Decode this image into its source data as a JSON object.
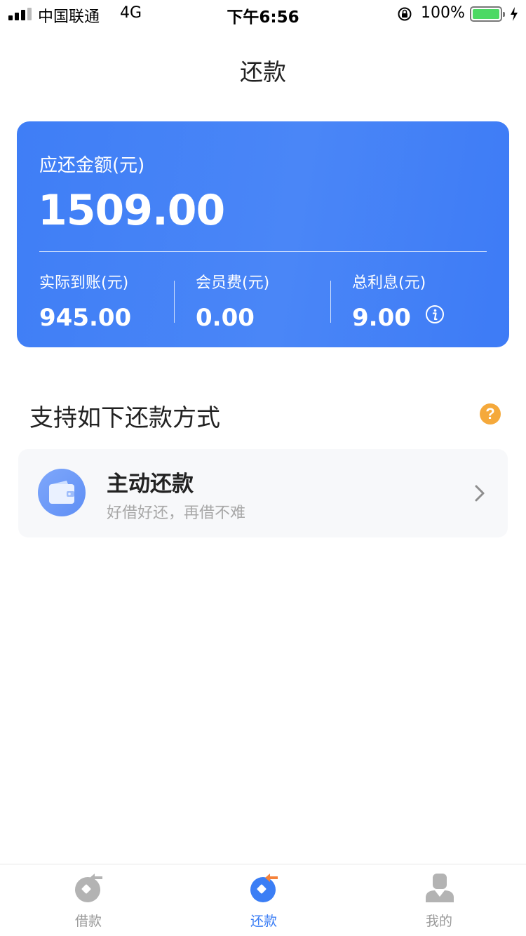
{
  "status_bar": {
    "carrier": "中国联通",
    "network": "4G",
    "time": "下午6:56",
    "battery_percent": "100%",
    "battery_level": 1.0,
    "battery_color": "#4cd964"
  },
  "nav": {
    "title": "还款"
  },
  "summary": {
    "due_label": "应还金额(元)",
    "due_amount": "1509.00",
    "received_label": "实际到账(元)",
    "received_value": "945.00",
    "fee_label": "会员费(元)",
    "fee_value": "0.00",
    "interest_label": "总利息(元)",
    "interest_value": "9.00",
    "card_color": "#4183f7"
  },
  "methods": {
    "title": "支持如下还款方式",
    "help_glyph": "?",
    "items": [
      {
        "title": "主动还款",
        "subtitle": "好借好还，再借不难",
        "icon": "wallet-icon"
      }
    ]
  },
  "tab_bar": {
    "tabs": [
      {
        "label": "借款",
        "icon": "borrow-icon",
        "active": false
      },
      {
        "label": "还款",
        "icon": "repay-icon",
        "active": true
      },
      {
        "label": "我的",
        "icon": "profile-icon",
        "active": false
      }
    ],
    "active_color": "#3b7ef5",
    "inactive_color": "#9a9a9a"
  }
}
